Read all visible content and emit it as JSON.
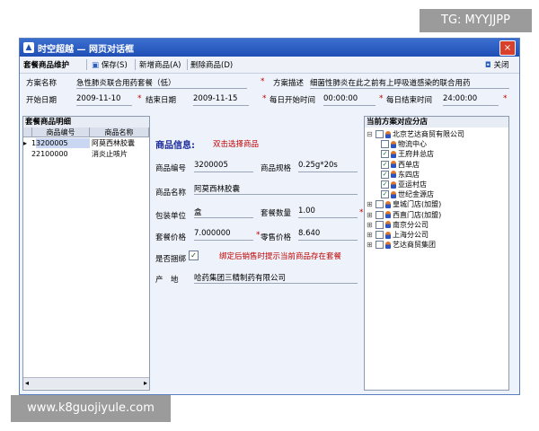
{
  "watermarks": {
    "top": "TG: MYYJJPP",
    "bottom": "www.k8guojiyule.com"
  },
  "window": {
    "title": "时空超越 — 网页对话框",
    "close_glyph": "×"
  },
  "toolbar": {
    "module": "套餐商品维护",
    "save": "保存(S)",
    "add": "新增商品(A)",
    "delete": "删除商品(D)",
    "close": "关闭"
  },
  "header": {
    "name_label": "方案名称",
    "name_value": "急性肺炎联合用药套餐（低）",
    "desc_label": "方案描述",
    "desc_value": "细菌性肺炎在此之前有上呼吸道感染的联合用药",
    "start_label": "开始日期",
    "start_value": "2009-11-10",
    "end_label": "结束日期",
    "end_value": "2009-11-15",
    "daystart_label": "每日开始时间",
    "daystart_value": "00:00:00",
    "dayend_label": "每日结束时间",
    "dayend_value": "24:00:00",
    "required_mark": "*"
  },
  "detail_panel": {
    "title": "套餐商品明细",
    "columns": [
      "商品编号",
      "商品名称"
    ],
    "rows": [
      {
        "no": "1",
        "code": "3200005",
        "name": "阿莫西林胶囊",
        "selected": true
      },
      {
        "no": "2",
        "code": "2100000",
        "name": "消炎止咳片",
        "selected": false
      }
    ]
  },
  "product_form": {
    "section_title": "商品信息:",
    "hint": "双击选择商品",
    "code_label": "商品编号",
    "code_value": "3200005",
    "spec_label": "商品规格",
    "spec_value": "0.25g*20s",
    "name_label": "商品名称",
    "name_value": "阿莫西林胶囊",
    "unit_label": "包装单位",
    "unit_value": "盒",
    "qty_label": "套餐数量",
    "qty_value": "1.00",
    "price_label": "套餐价格",
    "price_value": "7.000000",
    "retail_label": "零售价格",
    "retail_value": "8.640",
    "bind_label": "是否捆绑",
    "bind_checked": "✓",
    "bind_hint": "绑定后销售时提示当前商品存在套餐",
    "origin_label": "产　地",
    "origin_value": "哈药集团三精制药有限公司"
  },
  "stores_panel": {
    "title": "当前方案对应分店",
    "tree": [
      {
        "label": "北京艺达商贸有限公司",
        "level": 0,
        "checked": false,
        "expander": "⊟"
      },
      {
        "label": "物流中心",
        "level": 1,
        "checked": false
      },
      {
        "label": "王府井总店",
        "level": 1,
        "checked": true
      },
      {
        "label": "西单店",
        "level": 1,
        "checked": true
      },
      {
        "label": "东四店",
        "level": 1,
        "checked": true
      },
      {
        "label": "亚运村店",
        "level": 1,
        "checked": true
      },
      {
        "label": "世纪金源店",
        "level": 1,
        "checked": true
      },
      {
        "label": "皇城门店(加盟)",
        "level": 0,
        "checked": false,
        "expander": "⊞"
      },
      {
        "label": "西直门店(加盟)",
        "level": 0,
        "checked": false,
        "expander": "⊞"
      },
      {
        "label": "南京分公司",
        "level": 0,
        "checked": false,
        "expander": "⊞"
      },
      {
        "label": "上海分公司",
        "level": 0,
        "checked": false,
        "expander": "⊞"
      },
      {
        "label": "艺达商贸集团",
        "level": 0,
        "checked": false,
        "expander": "⊞"
      }
    ]
  },
  "colors": {
    "accent": "#1f4fb5",
    "required": "#c00000",
    "section": "#1a2a9a",
    "hint": "#c00000"
  }
}
